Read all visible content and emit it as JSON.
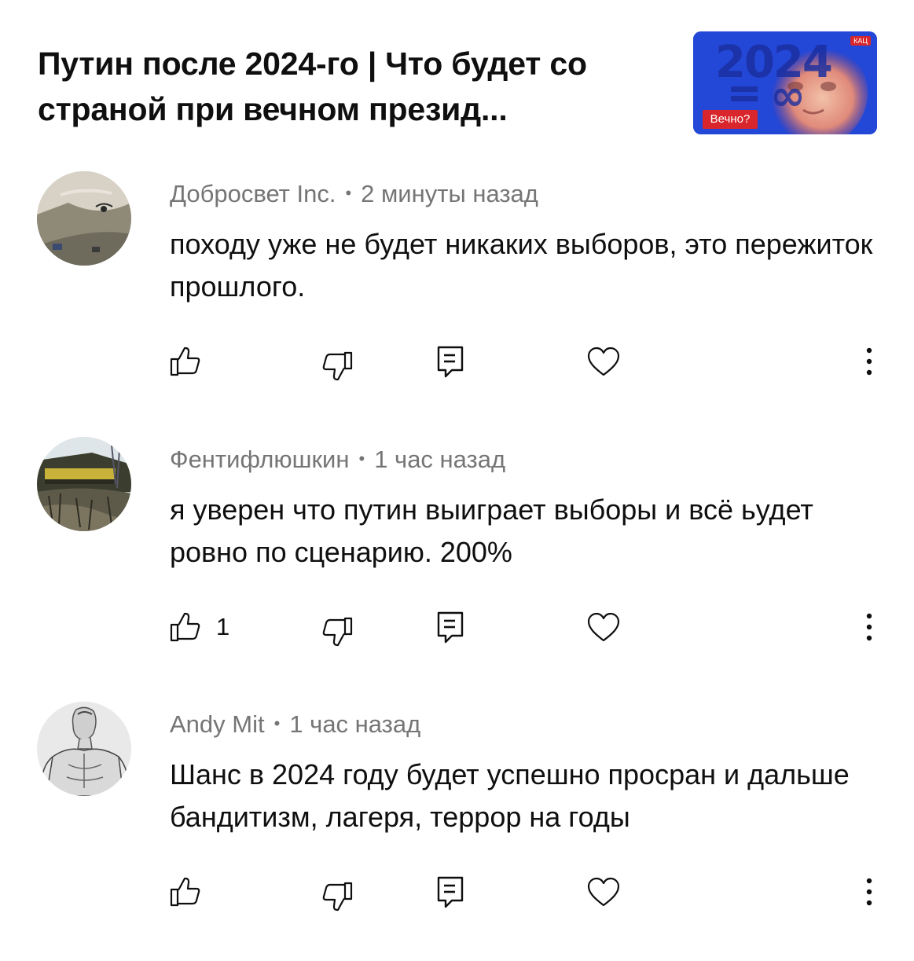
{
  "video": {
    "title": "Путин после 2024-го | Что будет со страной при вечном презид...",
    "thumbnail_label": "Вечно?",
    "thumbnail_channel": "КАЦ",
    "thumbnail_text": "2024 = ∞"
  },
  "comments": [
    {
      "author": "Добросвет Inc.",
      "separator": "•",
      "time": "2 минуты назад",
      "text": "походу уже не будет никаких выборов, это пережиток прошлого.",
      "likes": ""
    },
    {
      "author": "Фентифлюшкин",
      "separator": "•",
      "time": "1 час назад",
      "text": "я уверен что путин выиграет выборы и всё ьудет ровно по сценарию. 200%",
      "likes": "1"
    },
    {
      "author": "Andy Mit",
      "separator": "•",
      "time": "1 час назад",
      "text": "Шанс в 2024 году будет успешно просран и дальше бандитизм, лагеря, террор на годы",
      "likes": ""
    }
  ],
  "icons": {
    "like": "thumb-up-icon",
    "dislike": "thumb-down-icon",
    "reply": "reply-comment-icon",
    "heart": "heart-icon",
    "more": "more-vertical-icon"
  },
  "colors": {
    "text": "#0f0f0f",
    "meta": "#757575",
    "thumbnail_blue": "#2c55e0",
    "thumbnail_red": "#d8262c"
  }
}
